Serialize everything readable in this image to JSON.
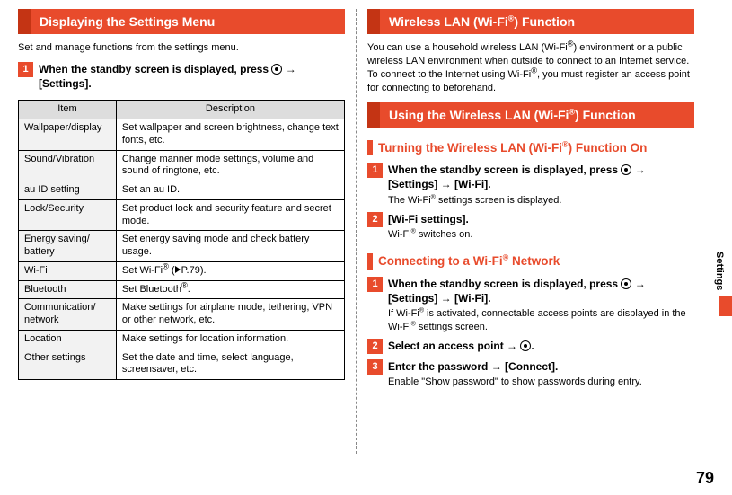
{
  "page_number": "79",
  "side_tab": "Settings",
  "left": {
    "banner": "Displaying the Settings Menu",
    "intro": "Set and manage functions from the settings menu.",
    "step1_prefix": "When the standby screen is displayed, press ",
    "step1_suffix": " [Settings].",
    "table": {
      "hdr_item": "Item",
      "hdr_desc": "Description",
      "rows": [
        {
          "item": "Wallpaper/display",
          "desc": "Set wallpaper and screen brightness, change text fonts, etc."
        },
        {
          "item": "Sound/Vibration",
          "desc": "Change manner mode settings, volume and sound of ringtone, etc."
        },
        {
          "item": "au ID setting",
          "desc": "Set an au ID."
        },
        {
          "item": "Lock/Security",
          "desc": "Set product lock and security feature and secret mode."
        },
        {
          "item": "Energy saving/ battery",
          "desc": "Set energy saving mode and check battery usage."
        },
        {
          "item": "Wi-Fi",
          "desc_prefix": "Set Wi-Fi",
          "desc_sup": "®",
          "desc_mid": " (",
          "desc_ref": "P.79",
          "desc_suffix": ")."
        },
        {
          "item": "Bluetooth",
          "desc_prefix": "Set Bluetooth",
          "desc_sup": "®",
          "desc_suffix": "."
        },
        {
          "item": "Communication/ network",
          "desc": "Make settings for airplane mode, tethering, VPN or other network, etc."
        },
        {
          "item": "Location",
          "desc": "Make settings for location information."
        },
        {
          "item": "Other settings",
          "desc": "Set the date and time, select language, screensaver, etc."
        }
      ]
    }
  },
  "right": {
    "banner_prefix": "Wireless LAN (Wi-Fi",
    "banner_sup": "®",
    "banner_suffix": ") Function",
    "intro_l1_a": "You can use a household wireless LAN (Wi-Fi",
    "intro_l1_b": ") environment or a public wireless LAN environment when outside to connect to an Internet service.",
    "intro_l2_a": "To connect to the Internet using Wi-Fi",
    "intro_l2_b": ", you must register an access point for connecting to beforehand.",
    "banner2_prefix": "Using the Wireless LAN (Wi-Fi",
    "banner2_suffix": ") Function",
    "sub1_prefix": "Turning the Wireless LAN (Wi-Fi",
    "sub1_suffix": ") Function On",
    "s1_step1_prefix": "When the standby screen is displayed, press ",
    "s1_step1_suffix": " [Settings] → [Wi-Fi].",
    "s1_step1_sub_a": "The Wi-Fi",
    "s1_step1_sub_b": " settings screen is displayed.",
    "s1_step2_title": "[Wi-Fi settings].",
    "s1_step2_sub_a": "Wi-Fi",
    "s1_step2_sub_b": " switches on.",
    "sub2_prefix": "Connecting to a Wi-Fi",
    "sub2_suffix": " Network",
    "s2_step1_prefix": "When the standby screen is displayed, press ",
    "s2_step1_suffix": " [Settings] → [Wi-Fi].",
    "s2_step1_sub_a": "If Wi-Fi",
    "s2_step1_sub_b": " is activated, connectable access points are displayed in the Wi-Fi",
    "s2_step1_sub_c": " settings screen.",
    "s2_step2_prefix": "Select an access point → ",
    "s2_step2_suffix": ".",
    "s2_step3_title": "Enter the password → [Connect].",
    "s2_step3_sub": "Enable \"Show password\" to show passwords during entry."
  }
}
